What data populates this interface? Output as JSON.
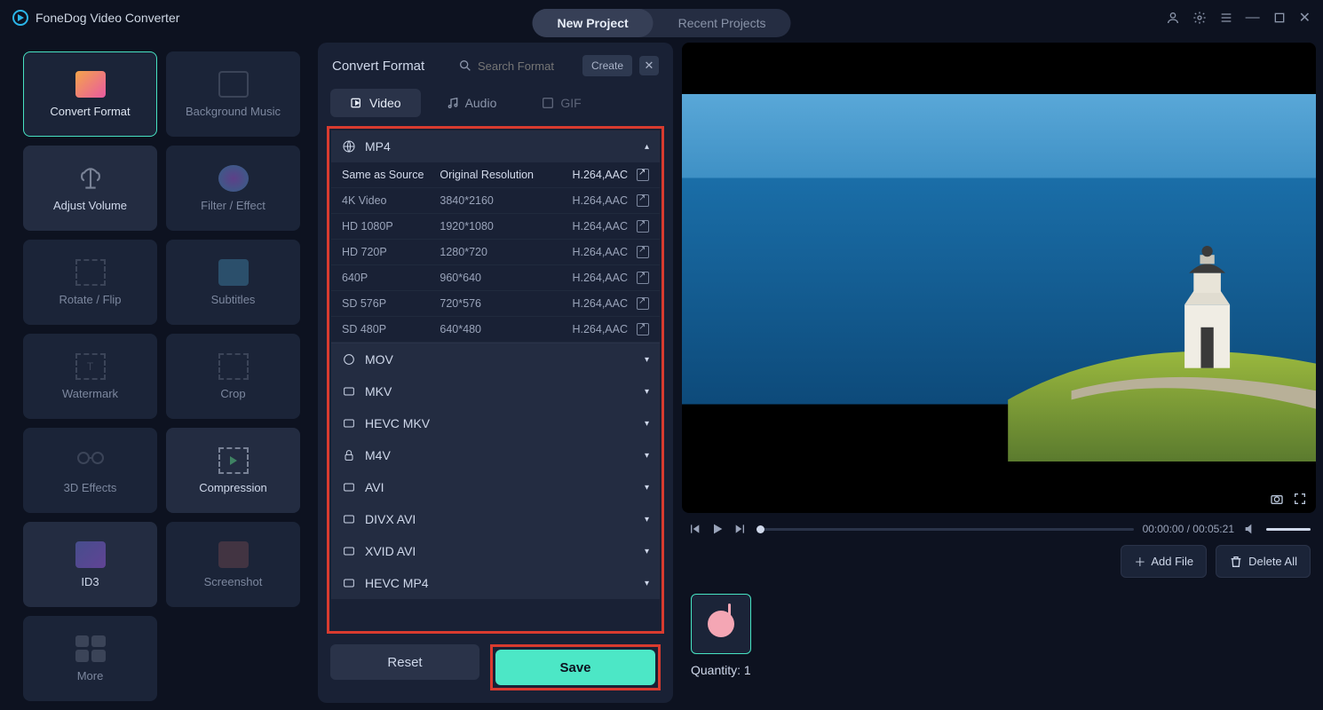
{
  "app_title": "FoneDog Video Converter",
  "top_tabs": {
    "new_project": "New Project",
    "recent_projects": "Recent Projects"
  },
  "sidebar": {
    "convert_format": "Convert Format",
    "background_music": "Background Music",
    "adjust_volume": "Adjust Volume",
    "filter_effect": "Filter / Effect",
    "rotate_flip": "Rotate / Flip",
    "subtitles": "Subtitles",
    "watermark": "Watermark",
    "crop": "Crop",
    "3d_effects": "3D Effects",
    "compression": "Compression",
    "id3": "ID3",
    "screenshot": "Screenshot",
    "more": "More"
  },
  "center": {
    "title": "Convert Format",
    "search_placeholder": "Search Format",
    "create": "Create",
    "tabs": {
      "video": "Video",
      "audio": "Audio",
      "gif": "GIF"
    },
    "mp4_label": "MP4",
    "cols": {
      "name": "Same as Source",
      "res": "Original Resolution",
      "codec": "H.264,AAC"
    },
    "rows": [
      {
        "name": "4K Video",
        "res": "3840*2160",
        "codec": "H.264,AAC"
      },
      {
        "name": "HD 1080P",
        "res": "1920*1080",
        "codec": "H.264,AAC"
      },
      {
        "name": "HD 720P",
        "res": "1280*720",
        "codec": "H.264,AAC"
      },
      {
        "name": "640P",
        "res": "960*640",
        "codec": "H.264,AAC"
      },
      {
        "name": "SD 576P",
        "res": "720*576",
        "codec": "H.264,AAC"
      },
      {
        "name": "SD 480P",
        "res": "640*480",
        "codec": "H.264,AAC"
      }
    ],
    "groups": [
      "MOV",
      "MKV",
      "HEVC MKV",
      "M4V",
      "AVI",
      "DIVX AVI",
      "XVID AVI",
      "HEVC MP4"
    ],
    "reset": "Reset",
    "save": "Save"
  },
  "player": {
    "time": "00:00:00 / 00:05:21"
  },
  "actions": {
    "add_file": "Add File",
    "delete_all": "Delete All"
  },
  "queue": {
    "quantity_label": "Quantity: 1"
  }
}
